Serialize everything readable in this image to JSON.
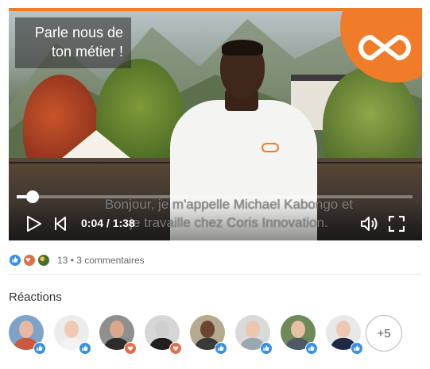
{
  "video": {
    "title_lines": [
      "Parle nous de",
      "ton métier !"
    ],
    "subtitle_lines": [
      "Bonjour, je m'appelle Michael Kabongo et",
      "je travaille chez Coris Innovation."
    ],
    "time": "0:04 / 1:38",
    "progress": 0.041,
    "accent_color": "#f07c2a",
    "icons": [
      "play-icon",
      "skip-back-icon",
      "volume-icon",
      "fullscreen-icon",
      "brand-logo-icon"
    ]
  },
  "social": {
    "reaction_icons": [
      "like-icon",
      "love-icon",
      "insightful-icon"
    ],
    "count": "13",
    "separator": "•",
    "comments": "3 commentaires"
  },
  "reactions": {
    "title": "Réactions",
    "more": "+5",
    "users": [
      {
        "badge": "like",
        "skin": "#e8b9a0",
        "shirt": "#c95a3b",
        "bg": "#7fa3c8"
      },
      {
        "badge": "like",
        "skin": "#f0c9b1",
        "shirt": "#f2f2f2",
        "bg": "#ececec"
      },
      {
        "badge": "love",
        "skin": "#d9a88c",
        "shirt": "#2c2c2c",
        "bg": "#8f8f8f"
      },
      {
        "badge": "love",
        "skin": "#cfcfcf",
        "shirt": "#1f1f1f",
        "bg": "#d6d6d6"
      },
      {
        "badge": "like",
        "skin": "#6b4532",
        "shirt": "#3a3a3a",
        "bg": "#b5a98f"
      },
      {
        "badge": "like",
        "skin": "#ecc6ae",
        "shirt": "#9aa6b0",
        "bg": "#dadada"
      },
      {
        "badge": "like",
        "skin": "#e6bfa5",
        "shirt": "#4d5a66",
        "bg": "#6e8a5a"
      },
      {
        "badge": "like",
        "skin": "#edc9b3",
        "shirt": "#1e2a44",
        "bg": "#e8e8e8"
      }
    ]
  }
}
